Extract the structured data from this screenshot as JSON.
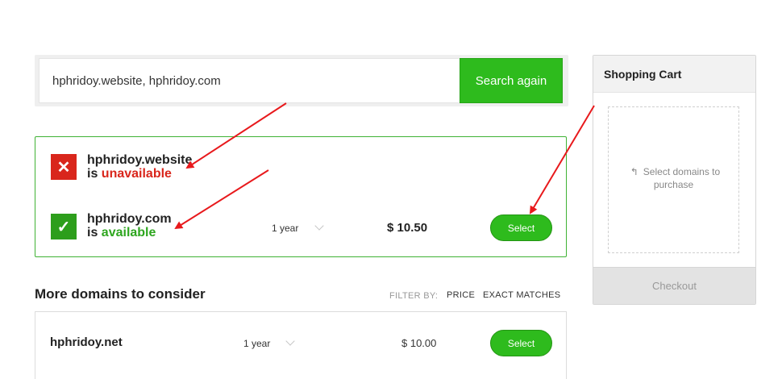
{
  "search": {
    "value": "hphridoy.website, hphridoy.com",
    "button_label": "Search again"
  },
  "results": [
    {
      "domain": "hphridoy.website",
      "status_prefix": "is",
      "status_word": "unavailable",
      "status_icon": "x-icon",
      "status_color": "#d9261c"
    },
    {
      "domain": "hphridoy.com",
      "status_prefix": "is",
      "status_word": "available",
      "status_icon": "checkmark-icon",
      "status_color": "#2ea61f",
      "term": "1 year",
      "price": "$ 10.50",
      "select_label": "Select"
    }
  ],
  "more": {
    "title": "More domains to consider",
    "filter_by": "FILTER BY:",
    "filter_price": "PRICE",
    "filter_exact": "EXACT MATCHES",
    "rows": [
      {
        "domain": "hphridoy.net",
        "term": "1 year",
        "price": "$ 10.00",
        "select_label": "Select"
      }
    ]
  },
  "cart": {
    "title": "Shopping Cart",
    "empty_message": "Select domains to purchase",
    "checkout_label": "Checkout"
  },
  "colors": {
    "accent_green": "#2ebb1d",
    "error_red": "#d9261c",
    "annotation_red": "#e8191c"
  }
}
